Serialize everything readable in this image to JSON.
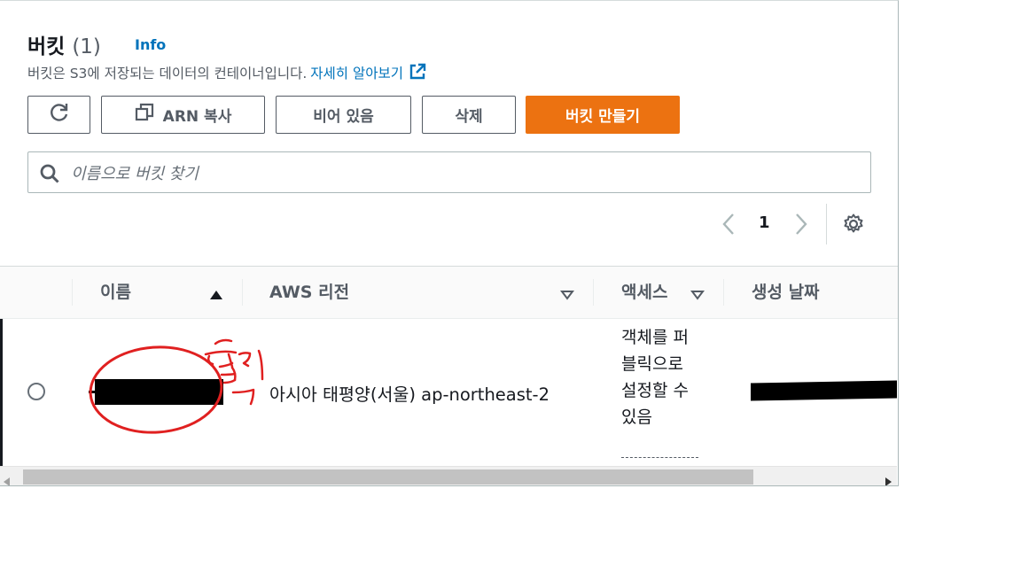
{
  "header": {
    "title": "버킷",
    "count": "(1)",
    "info_link": "Info",
    "description": "버킷은 S3에 저장되는 데이터의 컨테이너입니다.",
    "learn_more": "자세히 알아보기"
  },
  "toolbar": {
    "refresh_icon": "refresh-icon",
    "copy_arn_label": "ARN 복사",
    "empty_label": "비어 있음",
    "delete_label": "삭제",
    "create_label": "버킷 만들기",
    "primary_color": "#ec7211"
  },
  "search": {
    "placeholder": "이름으로 버킷 찾기",
    "value": ""
  },
  "pagination": {
    "current_page": "1"
  },
  "table": {
    "columns": [
      "이름",
      "AWS 리전",
      "액세스",
      "생성 날짜"
    ],
    "rows": [
      {
        "name": "",
        "region": "아시아 태평양(서울) ap-northeast-2",
        "access": "객체를 퍼블릭으로 설정할 수 있음",
        "created": ""
      }
    ]
  },
  "annotation": {
    "text": "클릭",
    "color": "#e02020"
  }
}
